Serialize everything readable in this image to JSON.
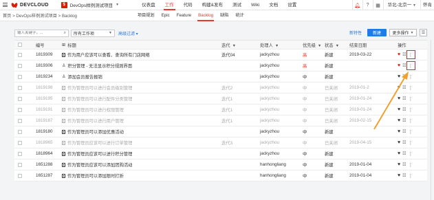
{
  "topbar": {
    "logo": "DEVCLOUD",
    "project": "DevOps样例测试项目",
    "nav": [
      "仪表盘",
      "工作",
      "代码",
      "构建&发布",
      "测试",
      "Wiki",
      "文档",
      "设置"
    ],
    "active_nav": "工作",
    "region": "华北-北京一",
    "user": "怀肯"
  },
  "subbar": {
    "breadcrumb": "首页 > DevOps样例测试项目 > Backlog",
    "tabs": [
      "项目规划",
      "Epic",
      "Feature",
      "Backlog",
      "缺陷",
      "统计"
    ],
    "active_tab": "Backlog"
  },
  "filters": {
    "search_placeholder": "输入关键字，...",
    "type_select": "所有工作项",
    "advanced": "高级过滤",
    "new_feature": "新特性",
    "new_button": "新建",
    "more_button": "更多操作"
  },
  "table": {
    "headers": {
      "id": "编号",
      "title": "标题",
      "iteration": "迭代",
      "assignee": "处理人",
      "priority": "优先级",
      "status": "状态",
      "end_date": "结束日期",
      "ops": "操作"
    },
    "rows": [
      {
        "id": "1819309",
        "title": "作为用户应该可以查看、查询所有门店网络",
        "iteration": "迭代04",
        "assignee": "jackyzhou",
        "priority": "高",
        "status": "新建",
        "end": "2019-03-22",
        "icon": "doc",
        "dim": false,
        "highlight": true
      },
      {
        "id": "1819306",
        "title": "积分管理 - 无法显示积分规则界面",
        "iteration": "",
        "assignee": "jackyzhou",
        "priority": "高",
        "status": "新建",
        "end": "",
        "icon": "user",
        "dim": false,
        "highlight": true
      },
      {
        "id": "1819234",
        "title": "添加会员报告报销",
        "iteration": "",
        "assignee": "jackyzhou",
        "priority": "中",
        "status": "新建",
        "end": "",
        "icon": "user",
        "dim": false,
        "highlight": false
      },
      {
        "id": "1819198",
        "title": "作为管理员可以进行会员级别管理",
        "iteration": "迭代2",
        "assignee": "jackyzhou",
        "priority": "中",
        "status": "已关闭",
        "end": "2019-01-2",
        "icon": "doc",
        "dim": true,
        "highlight": false
      },
      {
        "id": "1819195",
        "title": "作为管理员可以进行配件分类管理",
        "iteration": "迭代1",
        "assignee": "jackyzhou",
        "priority": "中",
        "status": "已关闭",
        "end": "2019-01-24",
        "icon": "doc",
        "dim": true,
        "highlight": false
      },
      {
        "id": "1819191",
        "title": "作为管理员可以进行权限管理",
        "iteration": "迭代1",
        "assignee": "jackyzhou",
        "priority": "中",
        "status": "已关闭",
        "end": "2019-01-24",
        "icon": "doc",
        "dim": true,
        "highlight": false
      },
      {
        "id": "1819187",
        "title": "作为管理员可以进行用户管理",
        "iteration": "迭代1",
        "assignee": "jackyzhou",
        "priority": "中",
        "status": "已关闭",
        "end": "2019-02-15",
        "icon": "doc",
        "dim": true,
        "highlight": false
      },
      {
        "id": "1819180",
        "title": "作为管理员可以添加优惠活动",
        "iteration": "",
        "assignee": "jackyzhou",
        "priority": "中",
        "status": "新建",
        "end": "",
        "icon": "doc",
        "dim": false,
        "highlight": false
      },
      {
        "id": "1818965",
        "title": "作为管理员应该可以进行订单管理",
        "iteration": "迭代3",
        "assignee": "jackyzhou",
        "priority": "中",
        "status": "已关闭",
        "end": "2019-04-15",
        "icon": "doc",
        "dim": true,
        "highlight": false
      },
      {
        "id": "1818964",
        "title": "作为管理员应该可以进行积分管理",
        "iteration": "",
        "assignee": "jackyzhou",
        "priority": "中",
        "status": "新建",
        "end": "",
        "icon": "doc",
        "dim": false,
        "highlight": false
      },
      {
        "id": "1651288",
        "title": "作为管理员应该可以添加团购活动",
        "iteration": "",
        "assignee": "hanhongliang",
        "priority": "中",
        "status": "新建",
        "end": "2019-01-04",
        "icon": "doc",
        "dim": false,
        "highlight": false
      },
      {
        "id": "1651287",
        "title": "作为管理员可以添加限时打折",
        "iteration": "",
        "assignee": "hanhongliang",
        "priority": "中",
        "status": "新建",
        "end": "2019-01-04",
        "icon": "doc",
        "dim": false,
        "highlight": false
      }
    ]
  },
  "colors": {
    "accent": "#e8372c",
    "primary_button": "#1e7ce6",
    "link": "#2a7bd6",
    "highlight_box": "#e3251b",
    "arrow": "#f0a030"
  }
}
